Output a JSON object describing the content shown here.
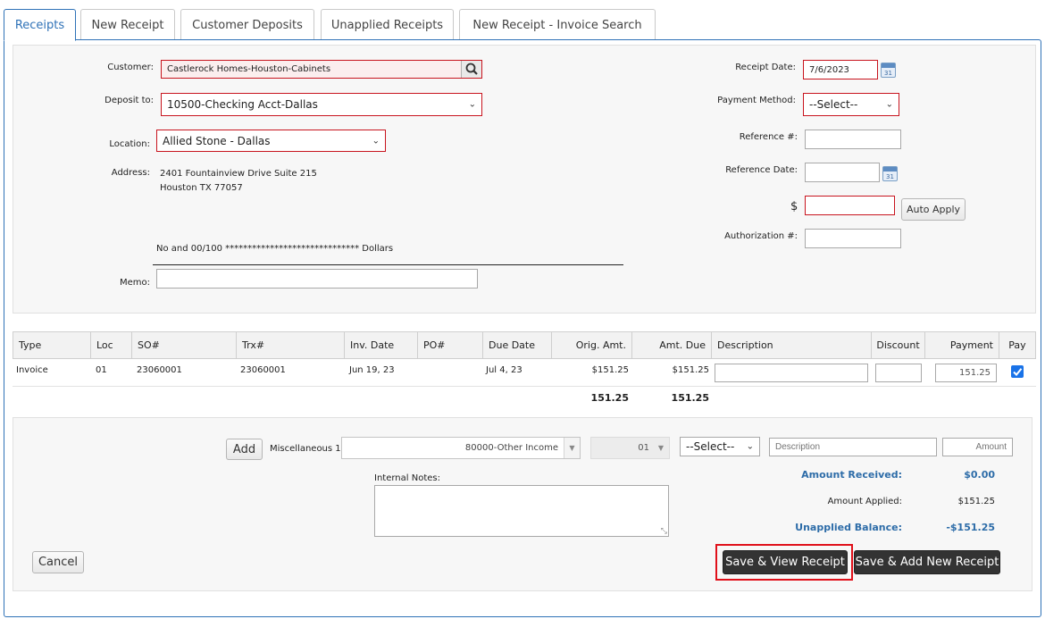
{
  "tabs": [
    {
      "label": "Receipts",
      "active": true
    },
    {
      "label": "New Receipt",
      "active": false
    },
    {
      "label": "Customer Deposits",
      "active": false
    },
    {
      "label": "Unapplied Receipts",
      "active": false
    },
    {
      "label": "New Receipt - Invoice Search",
      "active": false
    }
  ],
  "form": {
    "customer_label": "Customer:",
    "customer_value": "Castlerock Homes-Houston-Cabinets",
    "deposit_label": "Deposit to:",
    "deposit_value": "10500-Checking Acct-Dallas",
    "location_label": "Location:",
    "location_value": "Allied Stone - Dallas",
    "address_label": "Address:",
    "address_line1": "2401 Fountainview Drive   Suite 215",
    "address_line2": "Houston  TX   77057",
    "amount_words": "No and 00/100 ****************************** Dollars",
    "memo_label": "Memo:",
    "memo_value": "",
    "receipt_date_label": "Receipt Date:",
    "receipt_date_value": "7/6/2023",
    "payment_method_label": "Payment Method:",
    "payment_method_value": "--Select--",
    "reference_label": "Reference #:",
    "reference_value": "",
    "reference_date_label": "Reference Date:",
    "reference_date_value": "",
    "dollar_sign": "$",
    "amount_value": "",
    "auto_apply_label": "Auto Apply",
    "authorization_label": "Authorization #:",
    "authorization_value": "",
    "calendar_glyph": "31"
  },
  "table": {
    "headers": [
      "Type",
      "Loc",
      "SO#",
      "Trx#",
      "Inv. Date",
      "PO#",
      "Due Date",
      "Orig. Amt.",
      "Amt. Due",
      "Description",
      "Discount",
      "Payment",
      "Pay"
    ],
    "rows": [
      {
        "type": "Invoice",
        "loc": "01",
        "so": "23060001",
        "trx": "23060001",
        "inv_date": "Jun 19, 23",
        "po": "",
        "due_date": "Jul 4, 23",
        "orig_amt": "$151.25",
        "amt_due": "$151.25",
        "description": "",
        "discount": "",
        "payment": "151.25",
        "pay": true
      }
    ],
    "totals": {
      "orig_amt": "151.25",
      "amt_due": "151.25"
    }
  },
  "misc": {
    "add_label": "Add",
    "misc_label": "Miscellaneous 1",
    "account_value": "80000-Other Income",
    "loc_value": "01",
    "select_value": "--Select--",
    "description_placeholder": "Description",
    "amount_placeholder": "Amount",
    "internal_notes_label": "Internal Notes:",
    "internal_notes_value": ""
  },
  "summary": {
    "amount_received_label": "Amount Received:",
    "amount_received_value": "$0.00",
    "amount_applied_label": "Amount Applied:",
    "amount_applied_value": "$151.25",
    "unapplied_label": "Unapplied Balance:",
    "unapplied_value": "-$151.25"
  },
  "buttons": {
    "cancel": "Cancel",
    "save_view": "Save & View Receipt",
    "save_add": "Save & Add New Receipt"
  }
}
